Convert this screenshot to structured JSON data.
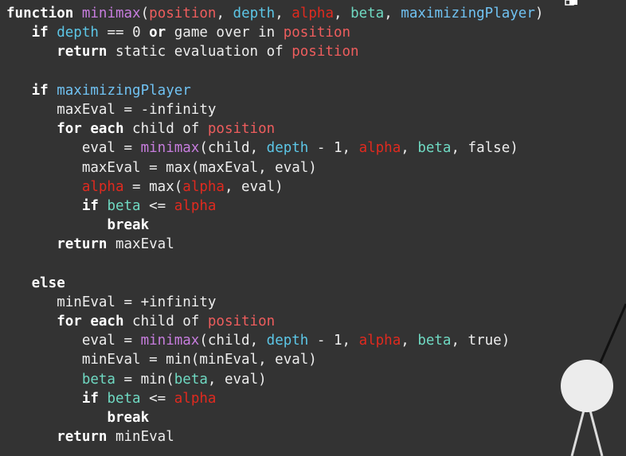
{
  "code": {
    "lines": [
      {
        "indent": 0,
        "tokens": [
          {
            "t": "function",
            "s": "kw"
          },
          {
            "t": " ",
            "s": "plain"
          },
          {
            "t": "minimax",
            "s": "fn"
          },
          {
            "t": "(",
            "s": "plain"
          },
          {
            "t": "position",
            "s": "pos"
          },
          {
            "t": ", ",
            "s": "plain"
          },
          {
            "t": "depth",
            "s": "depth"
          },
          {
            "t": ", ",
            "s": "plain"
          },
          {
            "t": "alpha",
            "s": "alpha"
          },
          {
            "t": ", ",
            "s": "plain"
          },
          {
            "t": "beta",
            "s": "beta"
          },
          {
            "t": ", ",
            "s": "plain"
          },
          {
            "t": "maximizingPlayer",
            "s": "maxp"
          },
          {
            "t": ")",
            "s": "plain"
          }
        ]
      },
      {
        "indent": 1,
        "tokens": [
          {
            "t": "if",
            "s": "kw"
          },
          {
            "t": " ",
            "s": "plain"
          },
          {
            "t": "depth",
            "s": "depth"
          },
          {
            "t": " == 0 ",
            "s": "plain"
          },
          {
            "t": "or",
            "s": "kw"
          },
          {
            "t": " game over in ",
            "s": "plain"
          },
          {
            "t": "position",
            "s": "pos"
          }
        ]
      },
      {
        "indent": 2,
        "tokens": [
          {
            "t": "return",
            "s": "kw"
          },
          {
            "t": " static evaluation of ",
            "s": "plain"
          },
          {
            "t": "position",
            "s": "pos"
          }
        ]
      },
      {
        "indent": 0,
        "tokens": []
      },
      {
        "indent": 1,
        "tokens": [
          {
            "t": "if",
            "s": "kw"
          },
          {
            "t": " ",
            "s": "plain"
          },
          {
            "t": "maximizingPlayer",
            "s": "maxp"
          }
        ]
      },
      {
        "indent": 2,
        "tokens": [
          {
            "t": "maxEval = -infinity",
            "s": "plain"
          }
        ]
      },
      {
        "indent": 2,
        "tokens": [
          {
            "t": "for each",
            "s": "kw"
          },
          {
            "t": " child of ",
            "s": "plain"
          },
          {
            "t": "position",
            "s": "pos"
          }
        ]
      },
      {
        "indent": 3,
        "tokens": [
          {
            "t": "eval = ",
            "s": "plain"
          },
          {
            "t": "minimax",
            "s": "fn"
          },
          {
            "t": "(child, ",
            "s": "plain"
          },
          {
            "t": "depth",
            "s": "depth"
          },
          {
            "t": " - 1, ",
            "s": "plain"
          },
          {
            "t": "alpha",
            "s": "alpha"
          },
          {
            "t": ", ",
            "s": "plain"
          },
          {
            "t": "beta",
            "s": "beta"
          },
          {
            "t": ", false)",
            "s": "plain"
          }
        ]
      },
      {
        "indent": 3,
        "tokens": [
          {
            "t": "maxEval = max(maxEval, eval)",
            "s": "plain"
          }
        ]
      },
      {
        "indent": 3,
        "tokens": [
          {
            "t": "alpha",
            "s": "alpha"
          },
          {
            "t": " = max(",
            "s": "plain"
          },
          {
            "t": "alpha",
            "s": "alpha"
          },
          {
            "t": ", eval)",
            "s": "plain"
          }
        ]
      },
      {
        "indent": 3,
        "tokens": [
          {
            "t": "if",
            "s": "kw"
          },
          {
            "t": " ",
            "s": "plain"
          },
          {
            "t": "beta",
            "s": "beta"
          },
          {
            "t": " <= ",
            "s": "plain"
          },
          {
            "t": "alpha",
            "s": "alpha"
          }
        ]
      },
      {
        "indent": 4,
        "tokens": [
          {
            "t": "break",
            "s": "kw"
          }
        ]
      },
      {
        "indent": 2,
        "tokens": [
          {
            "t": "return",
            "s": "kw"
          },
          {
            "t": " maxEval",
            "s": "plain"
          }
        ]
      },
      {
        "indent": 0,
        "tokens": []
      },
      {
        "indent": 1,
        "tokens": [
          {
            "t": "else",
            "s": "kw"
          }
        ]
      },
      {
        "indent": 2,
        "tokens": [
          {
            "t": "minEval = +infinity",
            "s": "plain"
          }
        ]
      },
      {
        "indent": 2,
        "tokens": [
          {
            "t": "for each",
            "s": "kw"
          },
          {
            "t": " child of ",
            "s": "plain"
          },
          {
            "t": "position",
            "s": "pos"
          }
        ]
      },
      {
        "indent": 3,
        "tokens": [
          {
            "t": "eval = ",
            "s": "plain"
          },
          {
            "t": "minimax",
            "s": "fn"
          },
          {
            "t": "(child, ",
            "s": "plain"
          },
          {
            "t": "depth",
            "s": "depth"
          },
          {
            "t": " - 1, ",
            "s": "plain"
          },
          {
            "t": "alpha",
            "s": "alpha"
          },
          {
            "t": ", ",
            "s": "plain"
          },
          {
            "t": "beta",
            "s": "beta"
          },
          {
            "t": ", true)",
            "s": "plain"
          }
        ]
      },
      {
        "indent": 3,
        "tokens": [
          {
            "t": "minEval = min(minEval, eval)",
            "s": "plain"
          }
        ]
      },
      {
        "indent": 3,
        "tokens": [
          {
            "t": "beta",
            "s": "beta"
          },
          {
            "t": " = min(",
            "s": "plain"
          },
          {
            "t": "beta",
            "s": "beta"
          },
          {
            "t": ", eval)",
            "s": "plain"
          }
        ]
      },
      {
        "indent": 3,
        "tokens": [
          {
            "t": "if",
            "s": "kw"
          },
          {
            "t": " ",
            "s": "plain"
          },
          {
            "t": "beta",
            "s": "beta"
          },
          {
            "t": " <= ",
            "s": "plain"
          },
          {
            "t": "alpha",
            "s": "alpha"
          }
        ]
      },
      {
        "indent": 4,
        "tokens": [
          {
            "t": "break",
            "s": "kw"
          }
        ]
      },
      {
        "indent": 2,
        "tokens": [
          {
            "t": "return",
            "s": "kw"
          },
          {
            "t": " minEval",
            "s": "plain"
          }
        ]
      }
    ]
  },
  "colors": {
    "background": "#333333",
    "keyword": "#ffffff",
    "function": "#c77dde",
    "position": "#ee5d5d",
    "alpha": "#e02a1f",
    "depth": "#5cc6e6",
    "beta": "#6fd9c2",
    "maximizingPlayer": "#70c2f2",
    "text": "#ededed",
    "tree_node": "#ececec"
  },
  "decorations": {
    "tree_node_icon": "circle-node-icon",
    "corner_icon": "copy-icon"
  }
}
